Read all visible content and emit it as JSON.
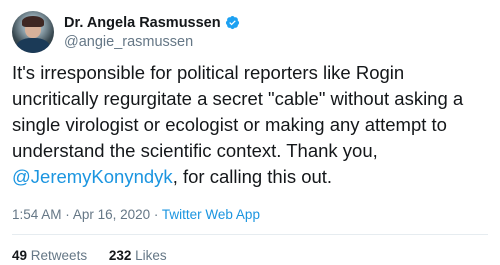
{
  "author": {
    "display_name": "Dr. Angela Rasmussen",
    "handle": "@angie_rasmussen",
    "verified": true
  },
  "tweet": {
    "text_before_mention": "It's irresponsible for political reporters like Rogin uncritically regurgitate a secret \"cable\" without asking a single virologist or ecologist or making any attempt to understand the scientific context. Thank you, ",
    "mention": "@JeremyKonyndyk",
    "text_after_mention": ", for calling this out.",
    "time": "1:54 AM",
    "date": "Apr 16, 2020",
    "separator": "·",
    "source": "Twitter Web App"
  },
  "stats": {
    "retweets_count": "49",
    "retweets_label": "Retweets",
    "likes_count": "232",
    "likes_label": "Likes"
  },
  "colors": {
    "link": "#1b95e0",
    "text": "#14171a",
    "muted": "#657786",
    "divider": "#e6ecf0"
  }
}
